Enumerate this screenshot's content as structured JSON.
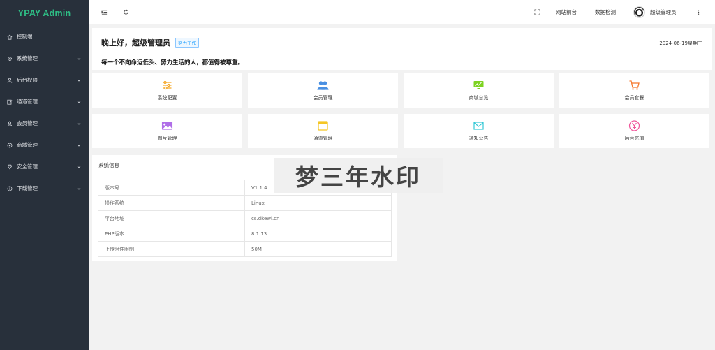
{
  "sidebar": {
    "logo": "YPAY Admin",
    "items": [
      {
        "label": "控制端",
        "icon": "home-icon"
      },
      {
        "label": "系统管理",
        "icon": "gear-icon"
      },
      {
        "label": "后台权限",
        "icon": "user-icon"
      },
      {
        "label": "通道管理",
        "icon": "edit-icon"
      },
      {
        "label": "会员管理",
        "icon": "user-icon"
      },
      {
        "label": "商城管理",
        "icon": "circle-dot-icon"
      },
      {
        "label": "安全管理",
        "icon": "diamond-icon"
      },
      {
        "label": "下载管理",
        "icon": "download-icon"
      }
    ]
  },
  "header": {
    "frontend_label": "网站前台",
    "data_check_label": "数据检测",
    "user_name": "超级管理员"
  },
  "welcome": {
    "greeting": "晚上好，超级管理员",
    "badge": "努力工作",
    "date": "2024-06-19星期三",
    "motto": "每一个不向命运低头、努力生活的人，都值得被尊重。"
  },
  "tiles": [
    {
      "label": "系统配置",
      "icon": "sliders-icon",
      "color": "#f5a623"
    },
    {
      "label": "会员管理",
      "icon": "users-icon",
      "color": "#4a90e2"
    },
    {
      "label": "商城总览",
      "icon": "monitor-chart-icon",
      "color": "#7ed321"
    },
    {
      "label": "会员套餐",
      "icon": "cart-icon",
      "color": "#f5762a"
    },
    {
      "label": "图片管理",
      "icon": "image-icon",
      "color": "#b06ee8"
    },
    {
      "label": "通道管理",
      "icon": "window-icon",
      "color": "#f5c623"
    },
    {
      "label": "通知公告",
      "icon": "mail-icon",
      "color": "#36c9d6"
    },
    {
      "label": "后台充值",
      "icon": "yen-icon",
      "color": "#f0569a"
    }
  ],
  "sysinfo": {
    "title": "系统信息",
    "rows": [
      {
        "key": "版本号",
        "value": "V1.1.4"
      },
      {
        "key": "操作系统",
        "value": "Linux"
      },
      {
        "key": "平台地址",
        "value": "cs.dkewl.cn"
      },
      {
        "key": "PHP版本",
        "value": "8.1.13"
      },
      {
        "key": "上传附件限制",
        "value": "50M"
      }
    ]
  },
  "watermark": "梦三年水印",
  "colors": {
    "sidebar_bg": "#28303b",
    "logo": "#2ebd85",
    "page_bg": "#f2f2f2",
    "badge": "#1e9fff"
  }
}
